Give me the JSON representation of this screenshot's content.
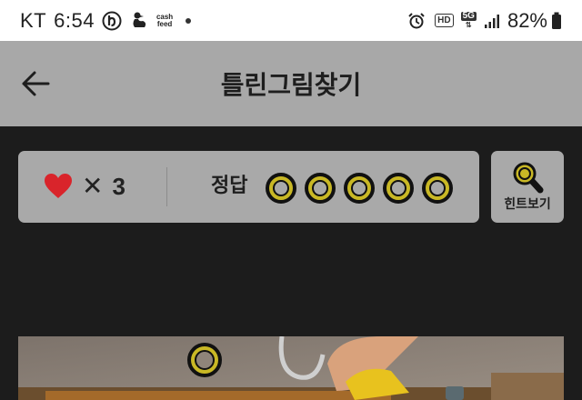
{
  "status_bar": {
    "carrier": "KT",
    "time": "6:54",
    "cash_line1": "cash",
    "cash_line2": "feed",
    "hd_label": "HD",
    "network_label": "5G",
    "battery_percent": "82%",
    "left_icons": [
      "b-app-icon",
      "duck-app-icon",
      "cashfeed-icon",
      "notification-dot"
    ],
    "right_icons": [
      "alarm-icon",
      "hd-voice-icon",
      "5g-icon",
      "signal-icon",
      "battery-icon"
    ]
  },
  "header": {
    "title": "틀린그림찾기",
    "back_icon": "back-arrow-icon"
  },
  "score_panel": {
    "lives_icon": "heart-icon",
    "lives_multiplier": "✕",
    "lives_count": "3",
    "answer_label": "정답",
    "answer_slots_total": 5,
    "answer_slots_found": 0
  },
  "hint": {
    "label": "힌트보기",
    "icon": "magnifier-icon"
  },
  "puzzle": {
    "markers_found": 1
  },
  "colors": {
    "background": "#1c1c1c",
    "panel": "#a9a9a9",
    "header": "#a8a8a8",
    "accent_yellow": "#c9b825",
    "heart_red": "#d9242b"
  }
}
